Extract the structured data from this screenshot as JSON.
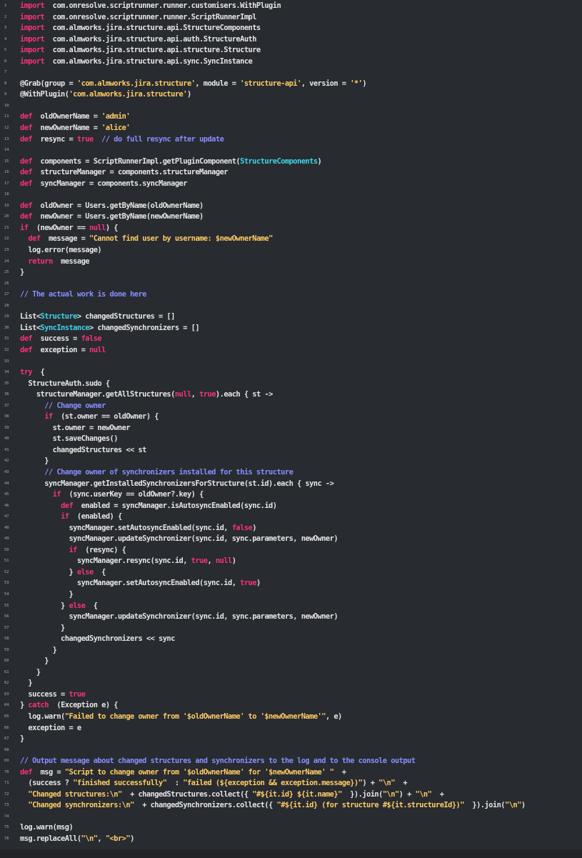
{
  "colors": {
    "background": "#282b30",
    "text": "#e6e6e6",
    "keyword": "#f5327a",
    "string": "#ffcc66",
    "type": "#3dd6e8",
    "comment": "#8a8dff",
    "line_number": "#a7a9ac"
  },
  "code_lines": [
    [
      [
        "k",
        "import"
      ],
      [
        "",
        "  com.onresolve.scriptrunner.runner.customisers.WithPlugin"
      ]
    ],
    [
      [
        "k",
        "import"
      ],
      [
        "",
        "  com.onresolve.scriptrunner.runner.ScriptRunnerImpl"
      ]
    ],
    [
      [
        "k",
        "import"
      ],
      [
        "",
        "  com.almworks.jira.structure.api.StructureComponents"
      ]
    ],
    [
      [
        "k",
        "import"
      ],
      [
        "",
        "  com.almworks.jira.structure.api.auth.StructureAuth"
      ]
    ],
    [
      [
        "k",
        "import"
      ],
      [
        "",
        "  com.almworks.jira.structure.api.structure.Structure"
      ]
    ],
    [
      [
        "k",
        "import"
      ],
      [
        "",
        "  com.almworks.jira.structure.api.sync.SyncInstance"
      ]
    ],
    [],
    [
      [
        "",
        "@Grab(group = "
      ],
      [
        "s",
        "'com.almworks.jira.structure'"
      ],
      [
        "",
        ", module = "
      ],
      [
        "s",
        "'structure-api'"
      ],
      [
        "",
        ", version = "
      ],
      [
        "s",
        "'*'"
      ],
      [
        "",
        ")"
      ]
    ],
    [
      [
        "",
        "@WithPlugin("
      ],
      [
        "s",
        "'com.almworks.jira.structure'"
      ],
      [
        "",
        ")"
      ]
    ],
    [],
    [
      [
        "k",
        "def"
      ],
      [
        "",
        "  oldOwnerName = "
      ],
      [
        "s",
        "'admin'"
      ]
    ],
    [
      [
        "k",
        "def"
      ],
      [
        "",
        "  newOwnerName = "
      ],
      [
        "s",
        "'alice'"
      ]
    ],
    [
      [
        "k",
        "def"
      ],
      [
        "",
        "  resync = "
      ],
      [
        "k",
        "true"
      ],
      [
        "c",
        "  // do full resync after update"
      ]
    ],
    [],
    [
      [
        "k",
        "def"
      ],
      [
        "",
        "  components = ScriptRunnerImpl.getPluginComponent("
      ],
      [
        "t",
        "StructureComponents"
      ],
      [
        "",
        ")"
      ]
    ],
    [
      [
        "k",
        "def"
      ],
      [
        "",
        "  structureManager = components.structureManager"
      ]
    ],
    [
      [
        "k",
        "def"
      ],
      [
        "",
        "  syncManager = components.syncManager"
      ]
    ],
    [],
    [
      [
        "k",
        "def"
      ],
      [
        "",
        "  oldOwner = Users.getByName(oldOwnerName)"
      ]
    ],
    [
      [
        "k",
        "def"
      ],
      [
        "",
        "  newOwner = Users.getByName(newOwnerName)"
      ]
    ],
    [
      [
        "k",
        "if"
      ],
      [
        "",
        "  (newOwner == "
      ],
      [
        "k",
        "null"
      ],
      [
        "",
        ") {"
      ]
    ],
    [
      [
        "",
        "  "
      ],
      [
        "k",
        "def"
      ],
      [
        "",
        "  message = "
      ],
      [
        "s",
        "\"Cannot find user by username: $newOwnerName\""
      ]
    ],
    [
      [
        "",
        "  log.error(message)"
      ]
    ],
    [
      [
        "",
        "  "
      ],
      [
        "k",
        "return"
      ],
      [
        "",
        "  message"
      ]
    ],
    [
      [
        "",
        "}"
      ]
    ],
    [],
    [
      [
        "c",
        "// The actual work is done here"
      ]
    ],
    [],
    [
      [
        "",
        "List<"
      ],
      [
        "t",
        "Structure"
      ],
      [
        "",
        "> changedStructures = []"
      ]
    ],
    [
      [
        "",
        "List<"
      ],
      [
        "t",
        "SyncInstance"
      ],
      [
        "",
        "> changedSynchronizers = []"
      ]
    ],
    [
      [
        "k",
        "def"
      ],
      [
        "",
        "  success = "
      ],
      [
        "k",
        "false"
      ]
    ],
    [
      [
        "k",
        "def"
      ],
      [
        "",
        "  exception = "
      ],
      [
        "k",
        "null"
      ]
    ],
    [],
    [
      [
        "k",
        "try"
      ],
      [
        "",
        "  {"
      ]
    ],
    [
      [
        "",
        "  StructureAuth.sudo {"
      ]
    ],
    [
      [
        "",
        "    structureManager.getAllStructures("
      ],
      [
        "k",
        "null"
      ],
      [
        "",
        ", "
      ],
      [
        "k",
        "true"
      ],
      [
        "",
        ").each { st ->"
      ]
    ],
    [
      [
        "",
        "      "
      ],
      [
        "c",
        "// Change owner"
      ]
    ],
    [
      [
        "",
        "      "
      ],
      [
        "k",
        "if"
      ],
      [
        "",
        "  (st.owner == oldOwner) {"
      ]
    ],
    [
      [
        "",
        "        st.owner = newOwner"
      ]
    ],
    [
      [
        "",
        "        st.saveChanges()"
      ]
    ],
    [
      [
        "",
        "        changedStructures << st"
      ]
    ],
    [
      [
        "",
        "      }"
      ]
    ],
    [
      [
        "",
        "      "
      ],
      [
        "c",
        "// Change owner of synchronizers installed for this structure"
      ]
    ],
    [
      [
        "",
        "      syncManager.getInstalledSynchronizersForStructure(st.id).each { sync ->"
      ]
    ],
    [
      [
        "",
        "        "
      ],
      [
        "k",
        "if"
      ],
      [
        "",
        "  (sync.userKey == oldOwner?.key) {"
      ]
    ],
    [
      [
        "",
        "          "
      ],
      [
        "k",
        "def"
      ],
      [
        "",
        "  enabled = syncManager.isAutosyncEnabled(sync.id)"
      ]
    ],
    [
      [
        "",
        "          "
      ],
      [
        "k",
        "if"
      ],
      [
        "",
        "  (enabled) {"
      ]
    ],
    [
      [
        "",
        "            syncManager.setAutosyncEnabled(sync.id, "
      ],
      [
        "k",
        "false"
      ],
      [
        "",
        ")"
      ]
    ],
    [
      [
        "",
        "            syncManager.updateSynchronizer(sync.id, sync.parameters, newOwner)"
      ]
    ],
    [
      [
        "",
        "            "
      ],
      [
        "k",
        "if"
      ],
      [
        "",
        "  (resync) {"
      ]
    ],
    [
      [
        "",
        "              syncManager.resync(sync.id, "
      ],
      [
        "k",
        "true"
      ],
      [
        "",
        ", "
      ],
      [
        "k",
        "null"
      ],
      [
        "",
        ")"
      ]
    ],
    [
      [
        "",
        "            } "
      ],
      [
        "k",
        "else"
      ],
      [
        "",
        "  {"
      ]
    ],
    [
      [
        "",
        "              syncManager.setAutosyncEnabled(sync.id, "
      ],
      [
        "k",
        "true"
      ],
      [
        "",
        ")"
      ]
    ],
    [
      [
        "",
        "            }"
      ]
    ],
    [
      [
        "",
        "          } "
      ],
      [
        "k",
        "else"
      ],
      [
        "",
        "  {"
      ]
    ],
    [
      [
        "",
        "            syncManager.updateSynchronizer(sync.id, sync.parameters, newOwner)"
      ]
    ],
    [
      [
        "",
        "          }"
      ]
    ],
    [
      [
        "",
        "          changedSynchronizers << sync"
      ]
    ],
    [
      [
        "",
        "        }"
      ]
    ],
    [
      [
        "",
        "      }"
      ]
    ],
    [
      [
        "",
        "    }"
      ]
    ],
    [
      [
        "",
        "  }"
      ]
    ],
    [
      [
        "",
        "  success = "
      ],
      [
        "k",
        "true"
      ]
    ],
    [
      [
        "",
        "} "
      ],
      [
        "k",
        "catch"
      ],
      [
        "",
        "  (Exception e) {"
      ]
    ],
    [
      [
        "",
        "  log.warn("
      ],
      [
        "s",
        "\"Failed to change owner from '$oldOwnerName' to '$newOwnerName'\""
      ],
      [
        "",
        ", e)"
      ]
    ],
    [
      [
        "",
        "  exception = e"
      ]
    ],
    [
      [
        "",
        "}"
      ]
    ],
    [],
    [
      [
        "c",
        "// Output message about changed structures and synchronizers to the log and to the console output"
      ]
    ],
    [
      [
        "k",
        "def"
      ],
      [
        "",
        "  msg = "
      ],
      [
        "s",
        "\"Script to change owner from '$oldOwnerName' for '$newOwnerName' \""
      ],
      [
        "",
        "  +"
      ]
    ],
    [
      [
        "",
        "  (success ? "
      ],
      [
        "s",
        "\"finished successfully\""
      ],
      [
        "",
        "  : "
      ],
      [
        "s",
        "\"failed (${exception && exception.message})\""
      ],
      [
        "",
        ") + "
      ],
      [
        "s",
        "\"\\n\""
      ],
      [
        "",
        "  +"
      ]
    ],
    [
      [
        "",
        "  "
      ],
      [
        "s",
        "\"Changed structures:\\n\""
      ],
      [
        "",
        "  + changedStructures.collect({ "
      ],
      [
        "s",
        "\"#${it.id} ${it.name}\""
      ],
      [
        "",
        "  }).join("
      ],
      [
        "s",
        "\"\\n\""
      ],
      [
        "",
        ") + "
      ],
      [
        "s",
        "\"\\n\""
      ],
      [
        "",
        "  +"
      ]
    ],
    [
      [
        "",
        "  "
      ],
      [
        "s",
        "\"Changed synchronizers:\\n\""
      ],
      [
        "",
        "  + changedSynchronizers.collect({ "
      ],
      [
        "s",
        "\"#${it.id} (for structure #${it.structureId})\""
      ],
      [
        "",
        "  }).join("
      ],
      [
        "s",
        "\"\\n\""
      ],
      [
        "",
        ")"
      ]
    ],
    [],
    [
      [
        "",
        "log.warn(msg)"
      ]
    ],
    [
      [
        "",
        "msg.replaceAll("
      ],
      [
        "s",
        "\"\\n\""
      ],
      [
        "",
        ", "
      ],
      [
        "s",
        "\"<br>\""
      ],
      [
        "",
        ")"
      ]
    ]
  ]
}
